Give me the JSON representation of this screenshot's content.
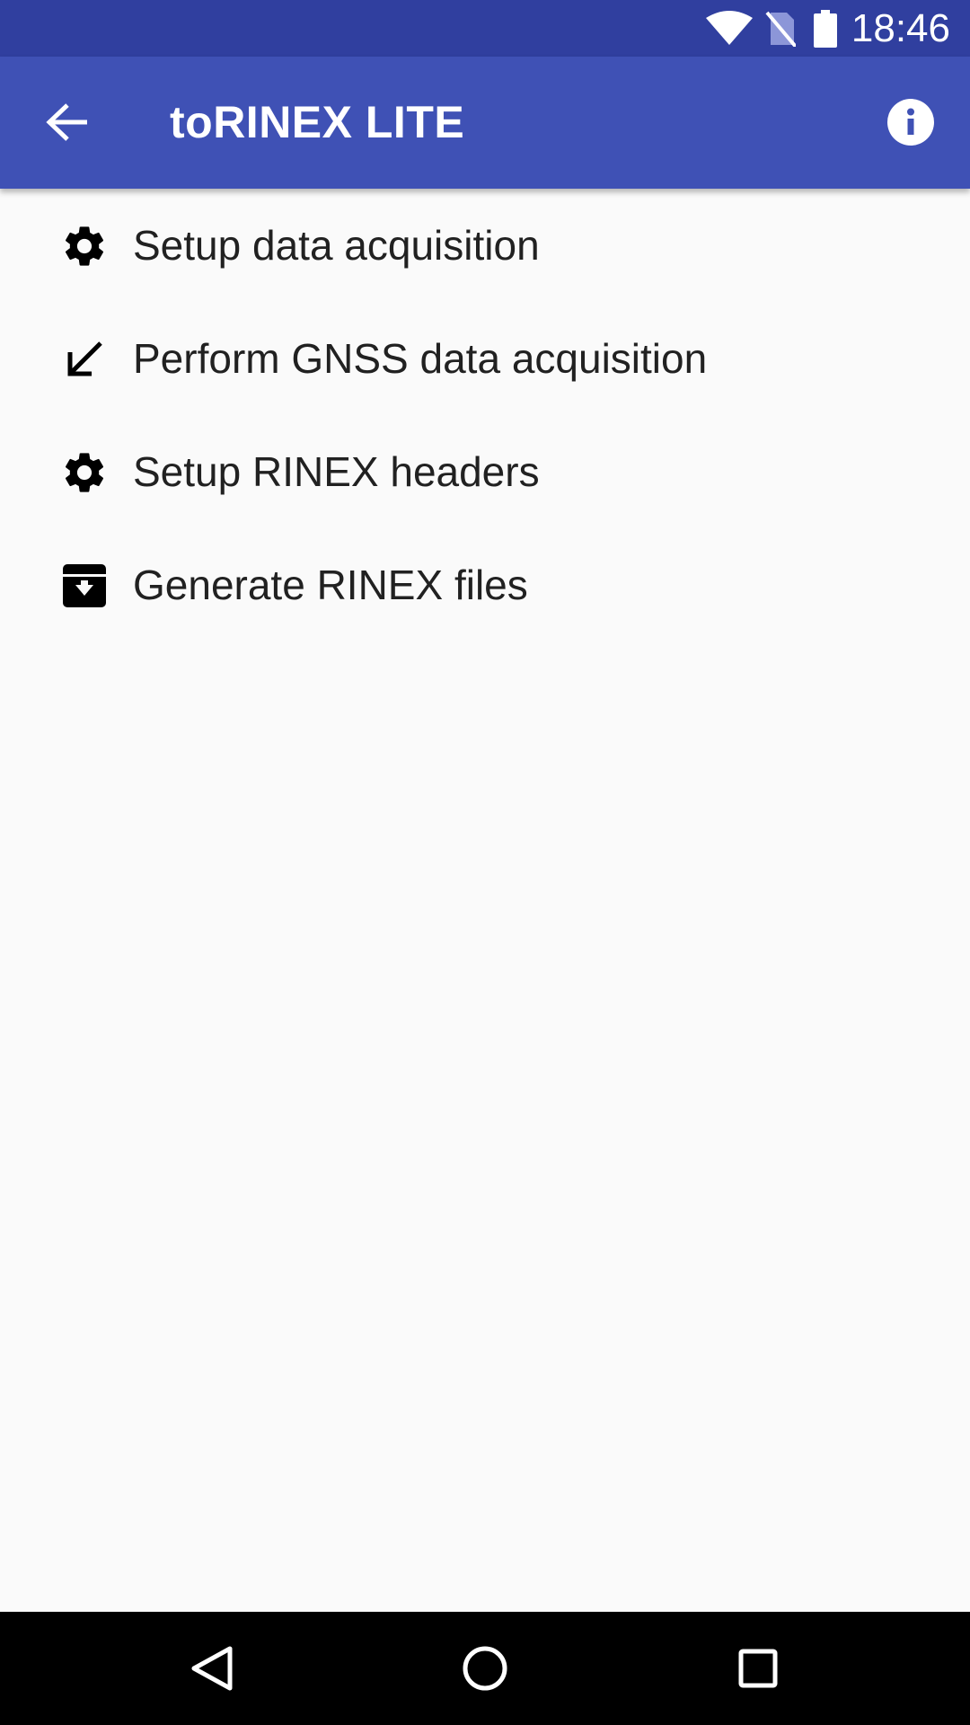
{
  "status_bar": {
    "time": "18:46",
    "icons": [
      "wifi-icon",
      "no-sim-icon",
      "battery-icon"
    ]
  },
  "app_bar": {
    "title": "toRINEX LITE",
    "back_icon": "arrow-left-icon",
    "info_icon": "info-icon"
  },
  "menu": {
    "items": [
      {
        "label": "Setup data acquisition",
        "icon": "gear-icon"
      },
      {
        "label": "Perform GNSS data acquisition",
        "icon": "arrow-down-left-icon"
      },
      {
        "label": "Setup RINEX headers",
        "icon": "gear-icon"
      },
      {
        "label": "Generate RINEX files",
        "icon": "archive-download-icon"
      }
    ]
  },
  "nav_bar": {
    "buttons": [
      "back-triangle-icon",
      "home-circle-icon",
      "recents-square-icon"
    ]
  },
  "colors": {
    "status_bar": "#303f9f",
    "app_bar": "#3f51b5",
    "background": "#fafafa",
    "text_primary": "#212121",
    "nav_bar": "#000000"
  }
}
